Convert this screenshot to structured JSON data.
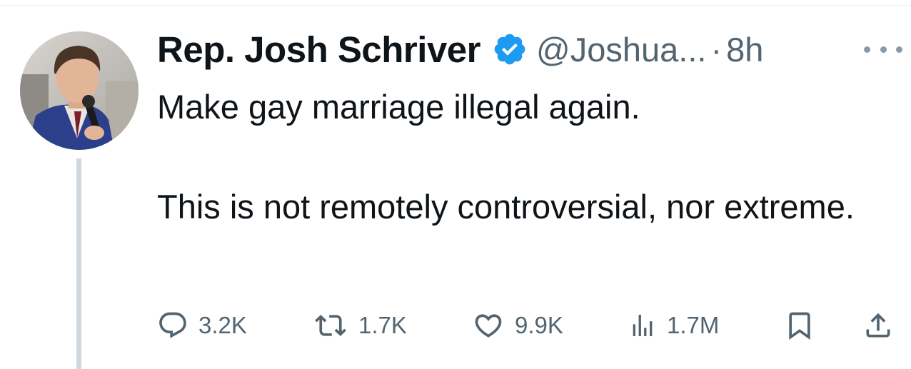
{
  "user": {
    "display_name": "Rep. Josh Schriver",
    "handle": "@Joshua...",
    "separator": "·",
    "time": "8h",
    "verified_color": "#1d9bf0"
  },
  "tweet": {
    "line1": "Make gay marriage illegal again.",
    "line2": "This is not remotely controversial, nor extreme."
  },
  "actions": {
    "reply_count": "3.2K",
    "retweet_count": "1.7K",
    "like_count": "9.9K",
    "views_count": "1.7M"
  },
  "icons": {
    "reply": "reply-icon",
    "retweet": "retweet-icon",
    "like": "heart-icon",
    "views": "views-icon",
    "bookmark": "bookmark-icon",
    "share": "share-icon",
    "more": "more-icon"
  },
  "colors": {
    "text": "#0f1419",
    "secondary": "#536471",
    "thread_line": "#cfd9de"
  }
}
